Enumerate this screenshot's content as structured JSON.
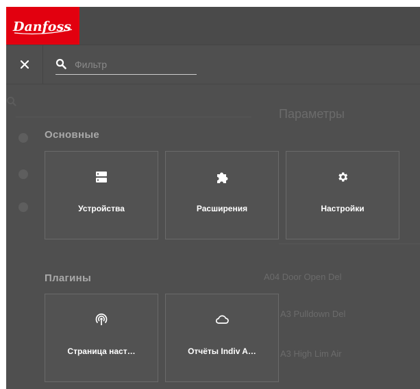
{
  "brand": {
    "logo_text": "Danfoss",
    "color": "#e2000f"
  },
  "menu": {
    "close_icon": "close-icon",
    "search": {
      "placeholder": "Фильтр",
      "value": ""
    }
  },
  "background_page": {
    "title": "Параметры",
    "items": [
      "A04 Door Open Del",
      "A3 Pulldown Del",
      "A3 High Lim Air"
    ]
  },
  "sections": [
    {
      "title": "Основные",
      "tiles": [
        {
          "label": "Устройства",
          "icon": "devices-icon"
        },
        {
          "label": "Расширения",
          "icon": "puzzle-icon"
        },
        {
          "label": "Настройки",
          "icon": "gear-icon"
        }
      ]
    },
    {
      "title": "Плагины",
      "tiles": [
        {
          "label": "Страница наст…",
          "icon": "broadcast-icon"
        },
        {
          "label": "Отчёты Indiv A…",
          "icon": "cloud-icon"
        }
      ]
    }
  ]
}
